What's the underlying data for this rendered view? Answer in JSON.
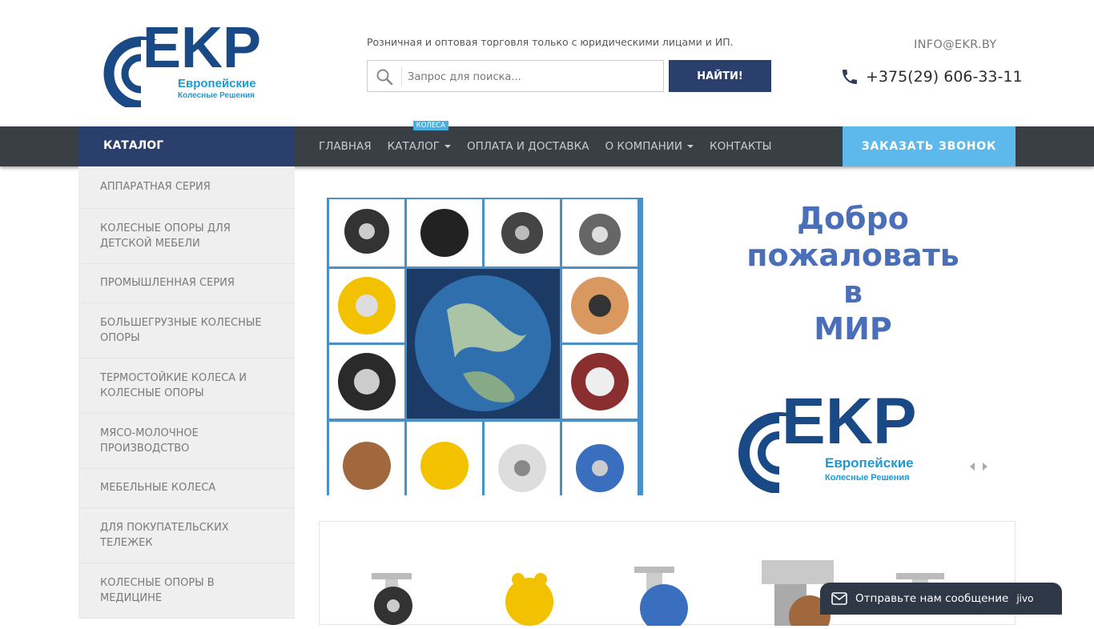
{
  "header": {
    "logo_letters": "EKP",
    "logo_line1": "Европейские",
    "logo_line2": "Колесные Решения",
    "tagline": "Розничная и оптовая торговля только с юридическими лицами и ИП.",
    "search_placeholder": "Запрос для поиска...",
    "search_button": "НАЙТИ!",
    "email": "INFO@EKR.BY",
    "phone": "+375(29) 606-33-11"
  },
  "nav": {
    "catalog_title": "КАТАЛОГ",
    "items": [
      {
        "label": "ГЛАВНАЯ",
        "dropdown": false
      },
      {
        "label": "КАТАЛОГ",
        "dropdown": true,
        "badge": "КОЛЕСА"
      },
      {
        "label": "ОПЛАТА И ДОСТАВКА",
        "dropdown": false
      },
      {
        "label": "О КОМПАНИИ",
        "dropdown": true
      },
      {
        "label": "КОНТАКТЫ",
        "dropdown": false
      }
    ],
    "callback_button": "ЗАКАЗАТЬ ЗВОНОК"
  },
  "sidebar": {
    "items": [
      {
        "line1": "АППАРАТНАЯ СЕРИЯ",
        "line2": ""
      },
      {
        "line1": "КОЛЕСНЫЕ ОПОРЫ ДЛЯ",
        "line2": "ДЕТСКОЙ МЕБЕЛИ"
      },
      {
        "line1": "ПРОМЫШЛЕННАЯ СЕРИЯ",
        "line2": ""
      },
      {
        "line1": "БОЛЬШЕГРУЗНЫЕ КОЛЕСНЫЕ",
        "line2": "ОПОРЫ"
      },
      {
        "line1": "ТЕРМОСТОЙКИЕ КОЛЕСА И",
        "line2": "КОЛЕСНЫЕ ОПОРЫ"
      },
      {
        "line1": "МЯСО-МОЛОЧНОЕ",
        "line2": "ПРОИЗВОДСТВО"
      },
      {
        "line1": "МЕБЕЛЬНЫЕ КОЛЕСА",
        "line2": ""
      },
      {
        "line1": "ДЛЯ ПОКУПАТЕЛЬСКИХ",
        "line2": "ТЕЛЕЖЕК"
      },
      {
        "line1": "КОЛЕСНЫЕ ОПОРЫ В",
        "line2": "МЕДИЦИНЕ"
      }
    ]
  },
  "slider": {
    "welcome_lines": [
      "Добро",
      "пожаловать",
      "в",
      "МИР"
    ],
    "logo_letters": "EKP",
    "logo_line1": "Европейские",
    "logo_line2": "Колесные Решения"
  },
  "chat": {
    "label": "Отправьте нам сообщение",
    "brand": "jivo"
  },
  "colors": {
    "brand_navy": "#2b3f6c",
    "nav_bar": "#3a3e45",
    "accent_blue": "#5db8ec",
    "logo_blue": "#1a4a86",
    "logo_cyan": "#1a9ad6"
  }
}
